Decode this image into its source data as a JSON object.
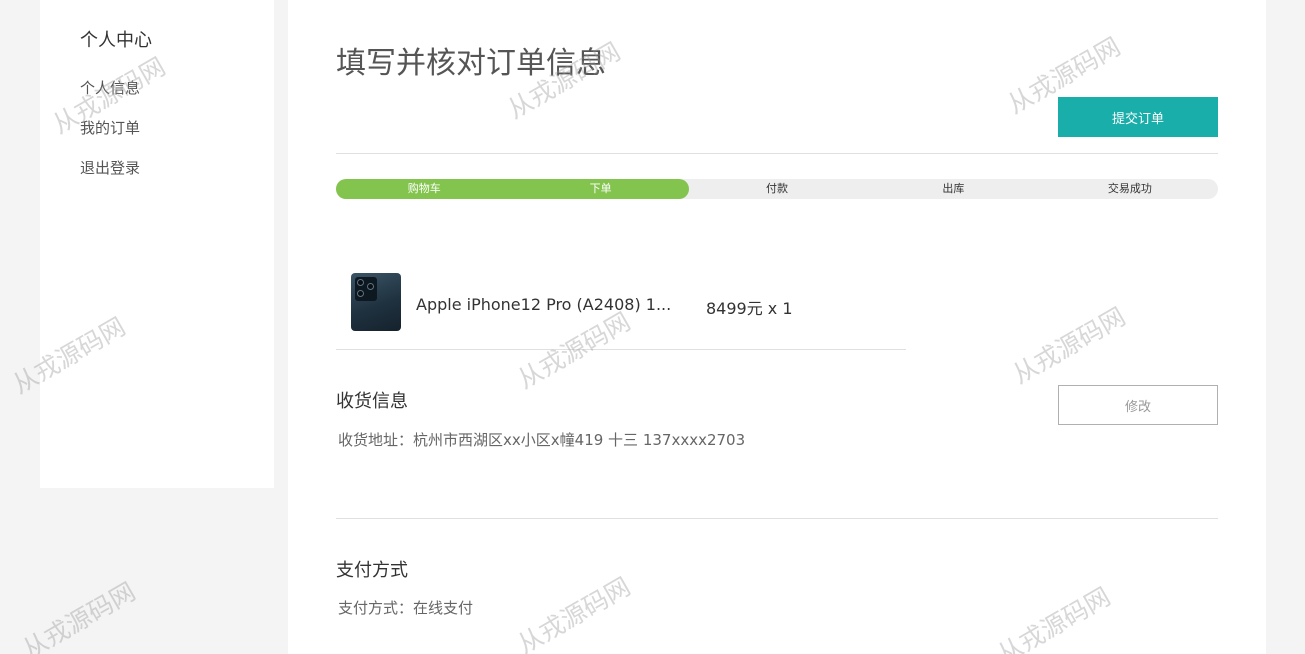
{
  "sidebar": {
    "title": "个人中心",
    "items": [
      {
        "label": "个人信息"
      },
      {
        "label": "我的订单"
      },
      {
        "label": "退出登录"
      }
    ]
  },
  "page": {
    "title": "填写并核对订单信息",
    "submit_label": "提交订单"
  },
  "progress": {
    "steps": [
      "购物车",
      "下单",
      "付款",
      "出库",
      "交易成功"
    ],
    "completed_steps": 2
  },
  "product": {
    "name": "Apple iPhone12 Pro (A2408) 1...",
    "price": "8499元 x 1",
    "image_icon": "iphone-product-image"
  },
  "shipping": {
    "title": "收货信息",
    "address_label": "收货地址：",
    "address": "杭州市西湖区xx小区x幢419 十三 137xxxx2703",
    "edit_label": "修改"
  },
  "payment": {
    "title": "支付方式",
    "method_label": "支付方式：",
    "method": "在线支付"
  },
  "watermark": {
    "text": "从戎源码网"
  },
  "colors": {
    "accent": "#1aaeaa",
    "progress_done": "#83c44e",
    "progress_track": "#eeeeee",
    "background": "#f4f4f4"
  }
}
